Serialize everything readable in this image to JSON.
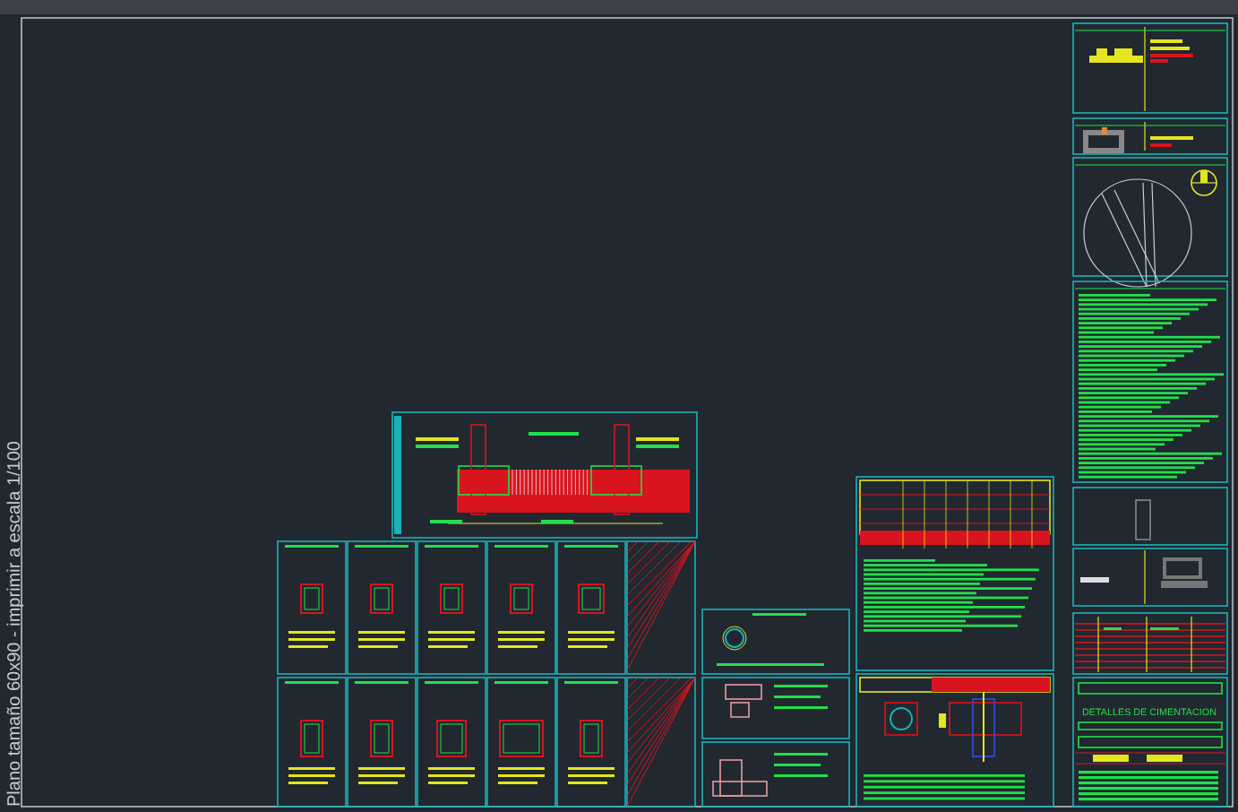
{
  "viewport": {
    "caption": "Plano tamaño 60x90 - imprimir a escala 1/100"
  },
  "title_block": {
    "drawing_title": "DETALLES DE CIMENTACION"
  }
}
